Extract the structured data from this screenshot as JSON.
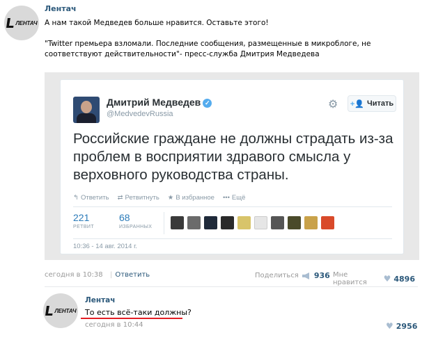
{
  "post": {
    "author": "Лентач",
    "logo_text": "ЛЕНТАЧ",
    "text_line1": "А нам такой Медведев больше нравится. Оставьте этого!",
    "text_line2": "\"Twitter премьера взломали. Последние сообщения, размещенные в микроблоге, не соответствуют действительности\"- пресс-служба Дмитрия Медведева",
    "date": "сегодня в 10:38",
    "reply_label": "Ответить",
    "share_label": "Поделиться",
    "share_count": "936",
    "like_label": "Мне нравится",
    "like_count": "4896"
  },
  "tweet": {
    "name": "Дмитрий Медведев",
    "handle": "@MedvedevRussia",
    "follow_label": "Читать",
    "body": "Российские граждане не должны страдать из-за проблем в восприятии здравого смысла у верховного руководства страны.",
    "actions": [
      {
        "icon": "reply-arrow-icon",
        "label": "Ответить"
      },
      {
        "icon": "retweet-icon",
        "label": "Ретвитнуть"
      },
      {
        "icon": "star-icon",
        "label": "В избранное"
      },
      {
        "icon": "more-dots-icon",
        "label": "Ещё"
      }
    ],
    "retweets_count": "221",
    "retweets_label": "РЕТВИТ",
    "favorites_count": "68",
    "favorites_label": "ИЗБРАННЫХ",
    "date": "10:36 - 14 авг. 2014 г."
  },
  "comment": {
    "author": "Лентач",
    "logo_text": "ЛЕНТАЧ",
    "text": "То есть всё-таки должны?",
    "date": "сегодня в 10:44",
    "like_count": "2956"
  },
  "colors": {
    "link": "#2b587a",
    "twitter_blue": "#55acee",
    "underline": "#e31e24"
  }
}
